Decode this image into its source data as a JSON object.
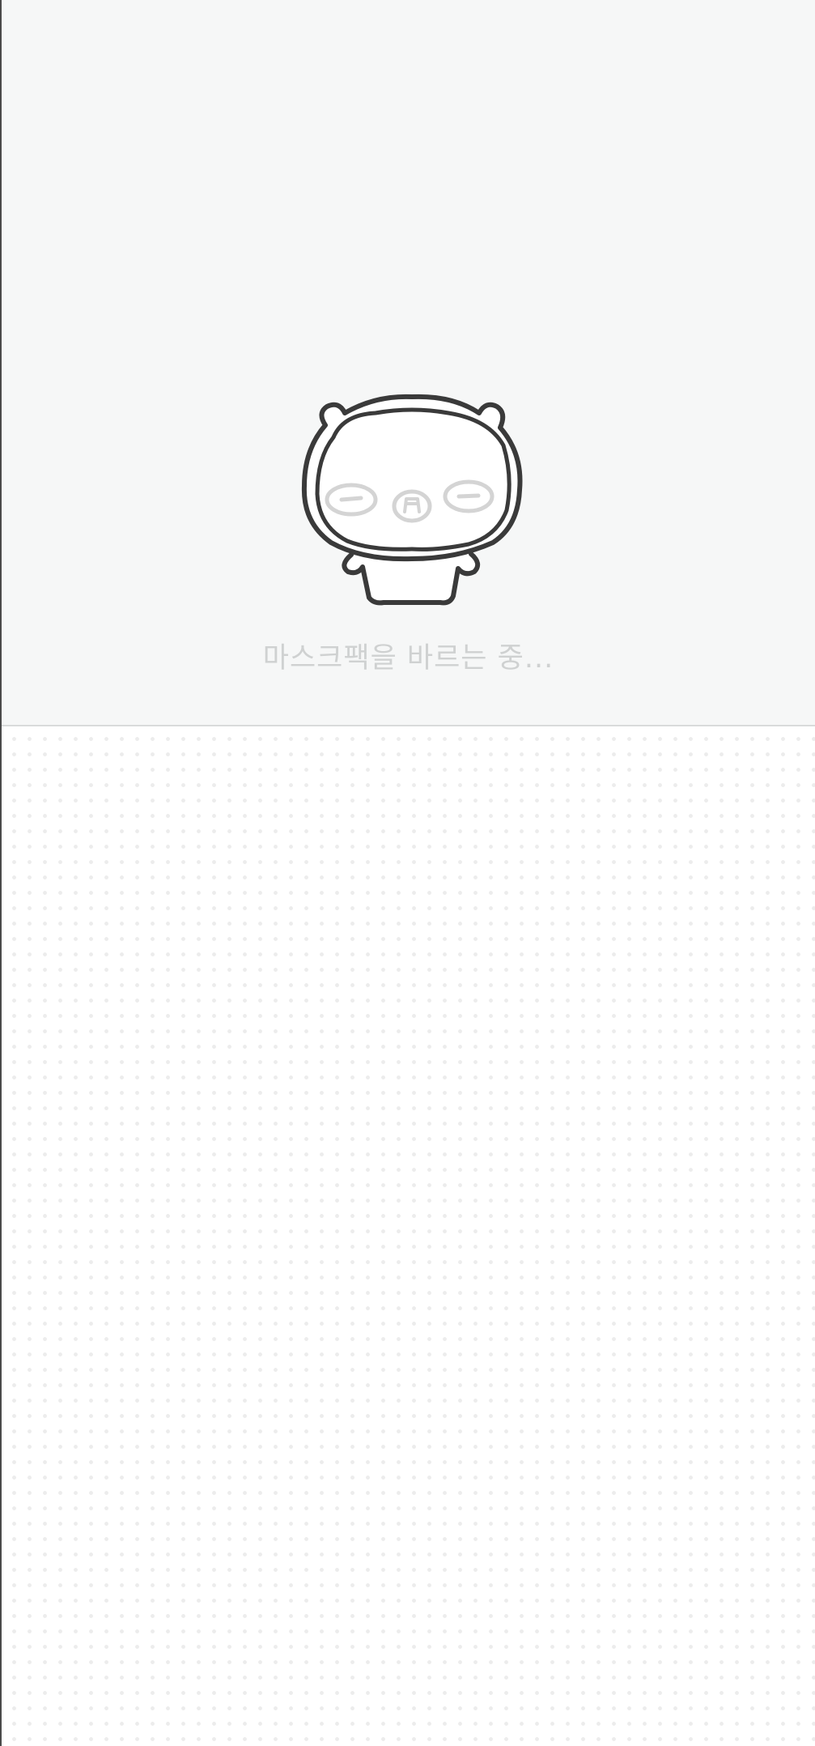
{
  "loading": {
    "message": "마스크팩을 바르는 중...",
    "illustration": "mascot-face-mask-icon"
  },
  "colors": {
    "top_background": "#f6f7f7",
    "bottom_background": "#ffffff",
    "pattern_dot": "#ececec",
    "text": "#cfd1d1",
    "outline": "#3a3a3a",
    "face_marks": "#d4d4d4"
  }
}
